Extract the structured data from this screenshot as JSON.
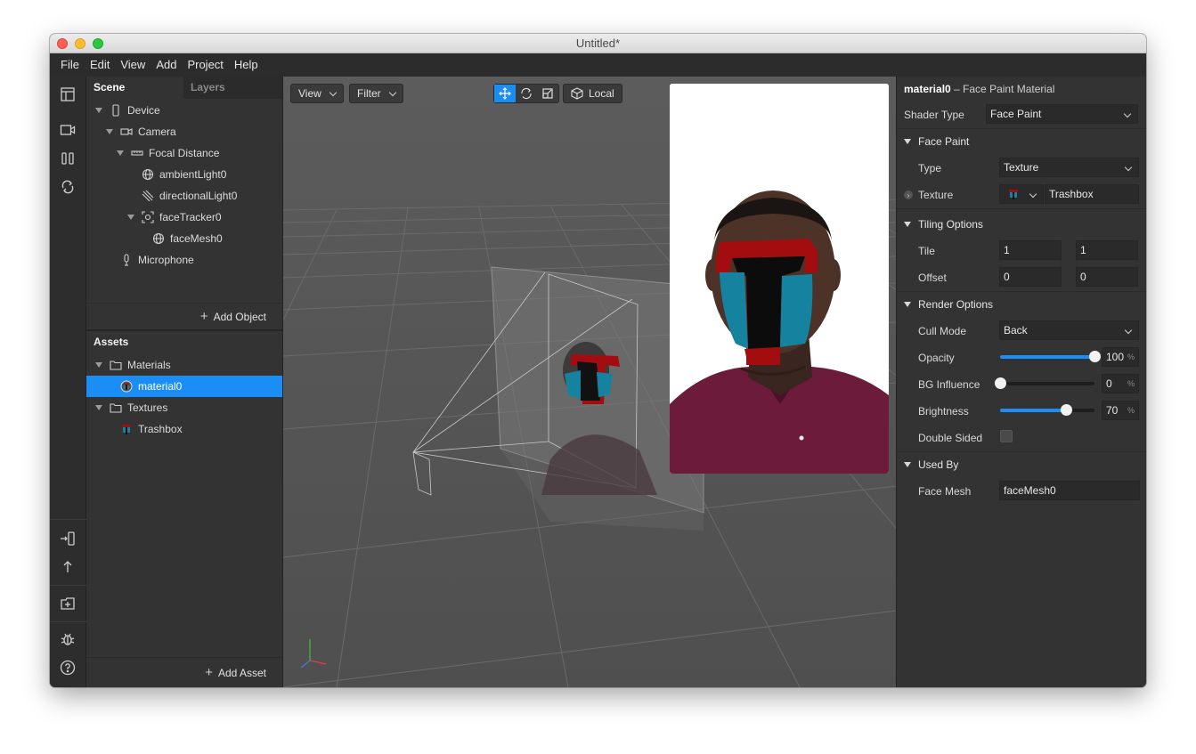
{
  "window": {
    "title": "Untitled*"
  },
  "menu": [
    "File",
    "Edit",
    "View",
    "Add",
    "Project",
    "Help"
  ],
  "scene_panel": {
    "tabs": [
      "Scene",
      "Layers"
    ],
    "tree": [
      "Device",
      "Camera",
      "Focal Distance",
      "ambientLight0",
      "directionalLight0",
      "faceTracker0",
      "faceMesh0",
      "Microphone"
    ],
    "add_object": "Add Object"
  },
  "assets_panel": {
    "title": "Assets",
    "tree": [
      "Materials",
      "material0",
      "Textures",
      "Trashbox"
    ],
    "add_asset": "Add Asset"
  },
  "viewport": {
    "view_label": "View",
    "filter_label": "Filter",
    "space_label": "Local"
  },
  "inspector": {
    "object_name": "material0",
    "object_type": "– Face Paint Material",
    "shader_type_label": "Shader Type",
    "shader_type_value": "Face Paint",
    "face_paint": {
      "header": "Face Paint",
      "type_label": "Type",
      "type_value": "Texture",
      "texture_label": "Texture",
      "texture_value": "Trashbox"
    },
    "tiling": {
      "header": "Tiling Options",
      "tile_label": "Tile",
      "tile_x": "1",
      "tile_y": "1",
      "offset_label": "Offset",
      "offset_x": "0",
      "offset_y": "0"
    },
    "render": {
      "header": "Render Options",
      "cull_mode_label": "Cull Mode",
      "cull_mode_value": "Back",
      "opacity_label": "Opacity",
      "opacity_value": "100",
      "opacity_fraction": 1.0,
      "bg_influence_label": "BG Influence",
      "bg_influence_value": "0",
      "bg_influence_fraction": 0.0,
      "brightness_label": "Brightness",
      "brightness_value": "70",
      "brightness_fraction": 0.7,
      "double_sided_label": "Double Sided",
      "pct_unit": "%"
    },
    "used_by": {
      "header": "Used By",
      "face_mesh_label": "Face Mesh",
      "face_mesh_value": "faceMesh0"
    }
  },
  "colors": {
    "accent": "#1a8ef4",
    "paint_red": "#a30d10",
    "paint_teal": "#1583a0"
  }
}
